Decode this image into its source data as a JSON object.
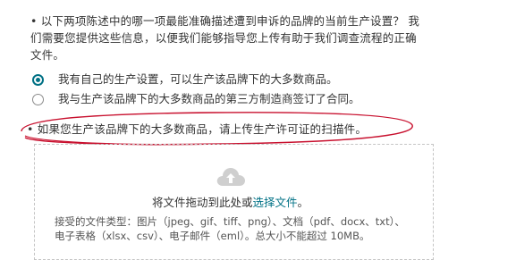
{
  "question1": {
    "text": "• 以下两项陈述中的哪一项最能准确描述遭到申诉的品牌的当前生产设置？ 我们需要您提供这些信息，以便我们能够指导您上传有助于我们调查流程的正确文件。"
  },
  "options": [
    {
      "label": "我有自己的生产设置，可以生产该品牌下的大多数商品。",
      "selected": true
    },
    {
      "label": "我与生产该品牌下的大多数商品的第三方制造商签订了合同。",
      "selected": false
    }
  ],
  "question2": {
    "text": "• 如果您生产该品牌下的大多数商品，请上传生产许可证的扫描件。"
  },
  "upload": {
    "instruction_prefix": "将文件拖动到此处或",
    "link_text": "选择文件",
    "instruction_suffix": "。",
    "accepted_types": "接受的文件类型：图片（jpeg、gif、tiff、png）、文档（pdf、docx、txt）、电子表格（xlsx、csv）、电子邮件（eml）。总大小不能超过 10MB。"
  },
  "colors": {
    "accent": "#007185",
    "annotation": "#c8102e",
    "text": "#333333"
  }
}
